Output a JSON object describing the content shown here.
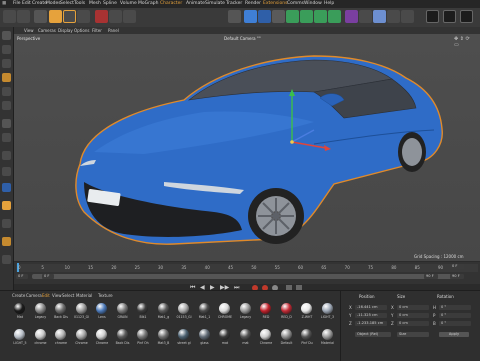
{
  "menu": {
    "items": [
      "File",
      "Edit",
      "Create",
      "Modes",
      "Select",
      "Tools",
      "Mesh",
      "Spline",
      "Volume",
      "MoGraph",
      "Character",
      "Animate",
      "Simulate",
      "Tracker",
      "Render",
      "Extensions",
      "Comms",
      "Window",
      "Help"
    ],
    "highlighted": [
      "Character",
      "Extensions"
    ]
  },
  "viewport": {
    "menu": [
      "View",
      "Cameras",
      "Display",
      "Options",
      "Filter",
      "Panel"
    ],
    "label": "Perspective",
    "camera": "Default Camera °°",
    "grid_spacing": "Grid Spacing : 12000 cm"
  },
  "timeline": {
    "ticks": [
      "0",
      "5",
      "10",
      "15",
      "20",
      "25",
      "30",
      "35",
      "40",
      "45",
      "50",
      "55",
      "60",
      "65",
      "70",
      "75",
      "80",
      "85",
      "90"
    ],
    "start_field": "0 F",
    "current_field": "0 F",
    "end_field": "90 F",
    "right_field_top": "0 F",
    "right_field_bottom": "90 F"
  },
  "material_manager": {
    "menu": [
      "Create",
      "Camera",
      "Edit",
      "View",
      "Select",
      "Material",
      "Texture"
    ],
    "row1_labels": [
      "Mat",
      "Legacy",
      "Back Dis",
      "01123_Gl",
      "Lens",
      "GRAIN",
      "Blk1",
      "Mat1_g",
      "01153_Gl",
      "Mat1_1",
      "CHROME",
      "Legacy",
      "RED",
      "RED_D",
      "Z-WHT",
      "LIGHT_3"
    ],
    "row2_labels": [
      "LIGHT_5",
      "chrome",
      "chrome",
      "Chrome",
      "Chrome",
      "Back Dis",
      "Pinf Oh",
      "Mat3_B",
      "street gl",
      "glass",
      "mat",
      "mat",
      "Chrome",
      "Default",
      "Pinf Du",
      "Material"
    ]
  },
  "attributes": {
    "columns": [
      "Position",
      "Size",
      "Rotation"
    ],
    "rows": [
      {
        "axis": "X",
        "position": "-16.441 cm",
        "size_axis": "X",
        "size": "0 cm",
        "rot_axis": "H",
        "rotation": "0 °"
      },
      {
        "axis": "Y",
        "position": "-11.325 cm",
        "size_axis": "Y",
        "size": "0 cm",
        "rot_axis": "P",
        "rotation": "0 °"
      },
      {
        "axis": "Z",
        "position": "-1.233.185 cm",
        "size_axis": "Z",
        "size": "0 cm",
        "rot_axis": "B",
        "rotation": "0 °"
      }
    ],
    "mode_select": "Object (Rel)",
    "size_select": "Size",
    "apply_label": "Apply"
  },
  "colors": {
    "car_body": "#2f6cc7",
    "accent": "#e6a23c",
    "selection_outline": "#e08a2a",
    "viewport_bg": "#4b4b4b"
  }
}
